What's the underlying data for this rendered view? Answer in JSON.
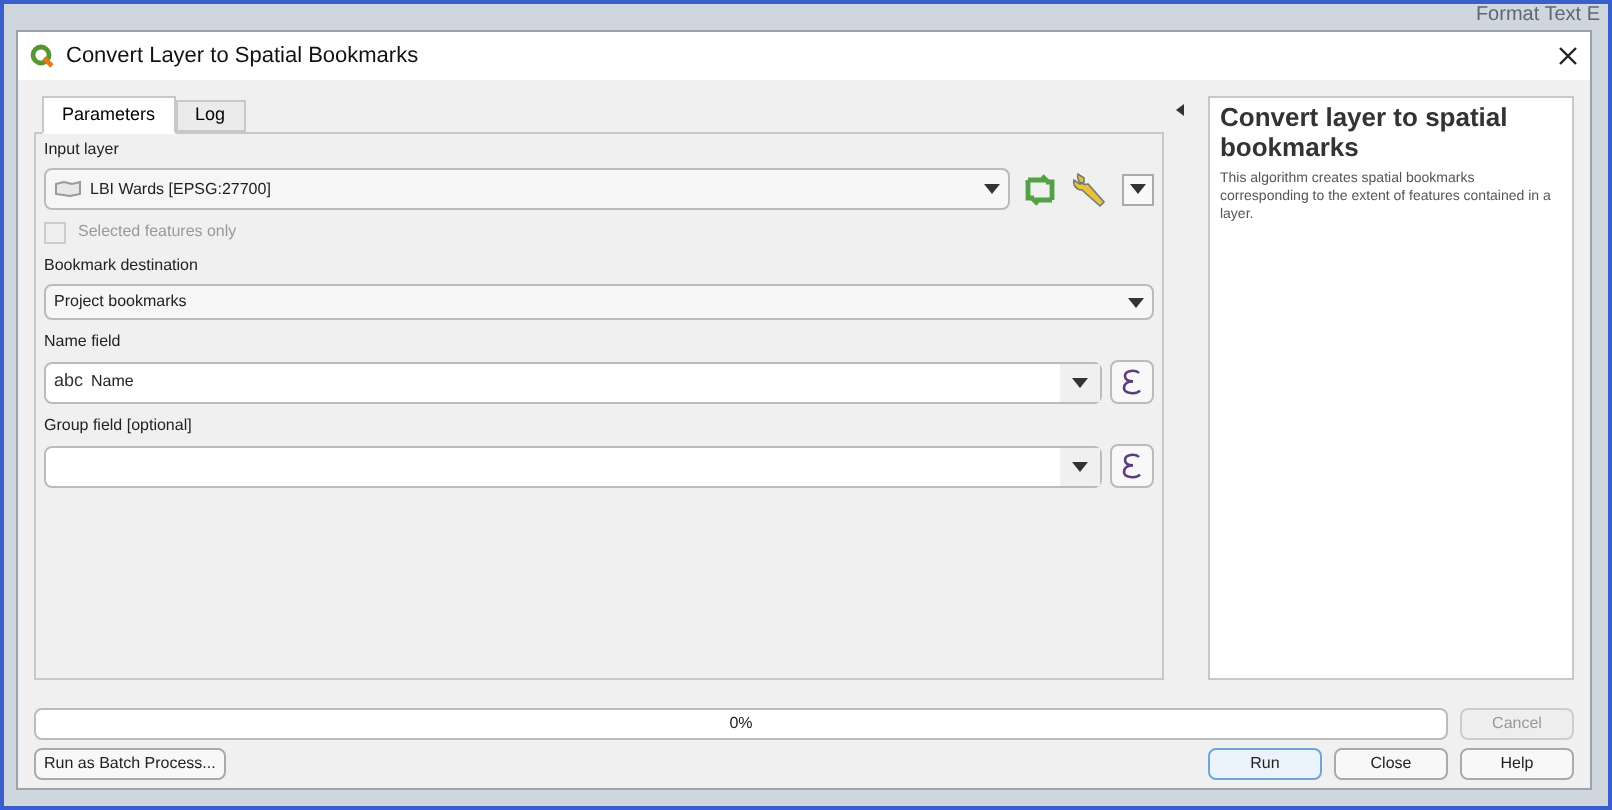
{
  "background_text": "Format Text E",
  "window": {
    "title": "Convert Layer to Spatial Bookmarks"
  },
  "tabs": [
    {
      "label": "Parameters",
      "selected": true
    },
    {
      "label": "Log",
      "selected": false
    }
  ],
  "parameters": [
    {
      "kind": "layer",
      "label": "Input layer",
      "value": "LBI Wards [EPSG:27700]"
    },
    {
      "kind": "checkbox",
      "label": "Selected features only",
      "checked": false,
      "disabled": true
    },
    {
      "kind": "combo",
      "label": "Bookmark destination",
      "value": "Project bookmarks"
    },
    {
      "kind": "field",
      "label": "Name field",
      "prefix": "abc",
      "value": "Name"
    },
    {
      "kind": "field",
      "label": "Group field [optional]"
    }
  ],
  "help": {
    "title": "Convert layer to spatial bookmarks",
    "text": "This algorithm creates spatial bookmarks corresponding to the extent of features contained in a layer."
  },
  "progress": {
    "level": 0,
    "reading": "0%"
  },
  "cancel_button": {
    "label": "Cancel",
    "disabled": true
  },
  "batch_button": "Run as Batch Process...",
  "buttons": [
    {
      "label": "Run",
      "kind": "default"
    },
    {
      "label": "Close",
      "kind": "normal"
    },
    {
      "label": "Help",
      "kind": "normal"
    }
  ]
}
